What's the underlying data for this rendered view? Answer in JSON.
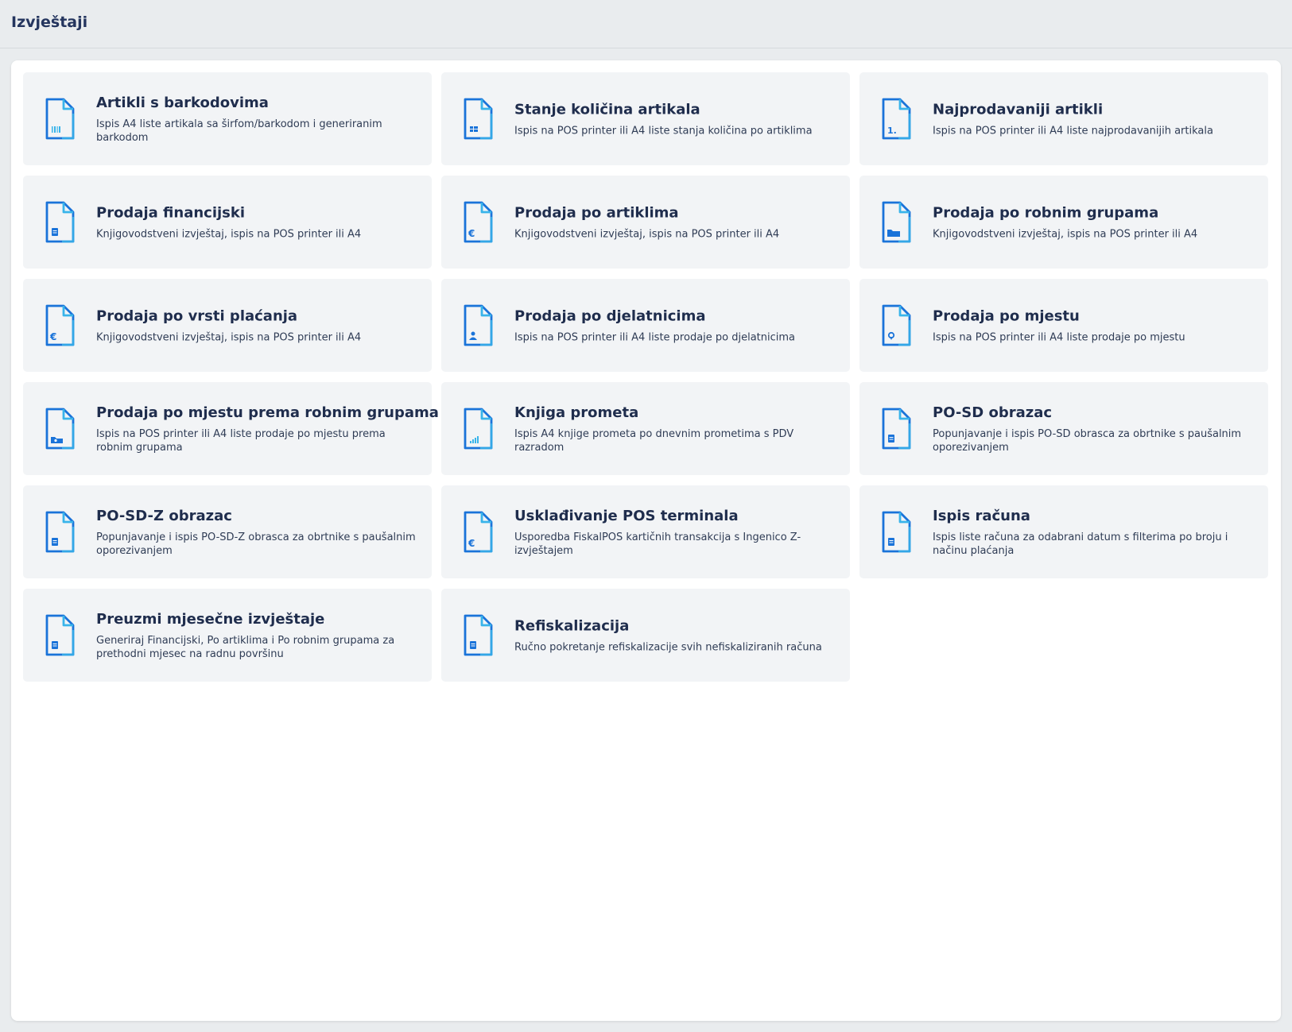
{
  "header": {
    "title": "Izvještaji"
  },
  "colors": {
    "accent": "#1a73d9",
    "accent_light": "#39b4ea",
    "card_bg": "#f2f4f6"
  },
  "reports": [
    {
      "id": "artikli-barkodovi",
      "icon": "barcode-document-icon",
      "title": "Artikli s barkodovima",
      "description": "Ispis A4 liste artikala sa širfom/barkodom i generiranim barkodom"
    },
    {
      "id": "stanje-kolicina",
      "icon": "stock-document-icon",
      "title": "Stanje količina artikala",
      "description": "Ispis na POS printer ili A4 liste stanja količina po artiklima"
    },
    {
      "id": "najprodavaniji",
      "icon": "ranking-document-icon",
      "title": "Najprodavaniji artikli",
      "description": "Ispis na POS printer ili A4 liste najprodavanijih artikala"
    },
    {
      "id": "prodaja-financijski",
      "icon": "finance-document-icon",
      "title": "Prodaja financijski",
      "description": "Knjigovodstveni izvještaj, ispis na POS printer ili A4"
    },
    {
      "id": "prodaja-artikli",
      "icon": "euro-document-icon",
      "title": "Prodaja po artiklima",
      "description": "Knjigovodstveni izvještaj, ispis na POS printer ili A4"
    },
    {
      "id": "prodaja-robne-grupe",
      "icon": "folder-document-icon",
      "title": "Prodaja po robnim grupama",
      "description": "Knjigovodstveni izvještaj, ispis na POS printer ili A4"
    },
    {
      "id": "prodaja-vrsta-placanja",
      "icon": "euro-document-icon",
      "title": "Prodaja po vrsti plaćanja",
      "description": "Knjigovodstveni izvještaj, ispis na POS printer ili A4"
    },
    {
      "id": "prodaja-djelatnici",
      "icon": "user-document-icon",
      "title": "Prodaja po djelatnicima",
      "description": "Ispis na POS printer ili A4 liste prodaje po djelatnicima"
    },
    {
      "id": "prodaja-mjesto",
      "icon": "location-document-icon",
      "title": "Prodaja po mjestu",
      "description": "Ispis na POS printer ili A4 liste prodaje po mjestu"
    },
    {
      "id": "prodaja-mjesto-grupe",
      "icon": "location-folder-document-icon",
      "title": "Prodaja po mjestu prema robnim grupama",
      "description": "Ispis na POS printer ili A4 liste prodaje po mjestu prema robnim grupama"
    },
    {
      "id": "knjiga-prometa",
      "icon": "chart-document-icon",
      "title": "Knjiga prometa",
      "description": "Ispis A4 knjige prometa po dnevnim prometima s PDV razradom"
    },
    {
      "id": "po-sd",
      "icon": "form-document-icon",
      "title": "PO-SD obrazac",
      "description": "Popunjavanje i ispis PO-SD obrasca za obrtnike s paušalnim oporezivanjem"
    },
    {
      "id": "po-sd-z",
      "icon": "form-document-icon",
      "title": "PO-SD-Z obrazac",
      "description": "Popunjavanje i ispis PO-SD-Z obrasca za obrtnike s paušalnim oporezivanjem"
    },
    {
      "id": "uskladivanje-pos",
      "icon": "euro-document-icon",
      "title": "Usklađivanje POS terminala",
      "description": "Usporedba FiskalPOS kartičnih transakcija s Ingenico Z-izvještajem"
    },
    {
      "id": "ispis-racuna",
      "icon": "receipt-document-icon",
      "title": "Ispis računa",
      "description": "Ispis liste računa za odabrani datum s filterima po broju i načinu plaćanja"
    },
    {
      "id": "preuzmi-mjesecne",
      "icon": "download-document-icon",
      "title": "Preuzmi mjesečne izvještaje",
      "description": "Generiraj Financijski, Po artiklima i Po robnim grupama za prethodni mjesec na radnu površinu"
    },
    {
      "id": "refiskalizacija",
      "icon": "refresh-document-icon",
      "title": "Refiskalizacija",
      "description": "Ručno pokretanje refiskalizacije svih nefiskaliziranih računa"
    }
  ]
}
